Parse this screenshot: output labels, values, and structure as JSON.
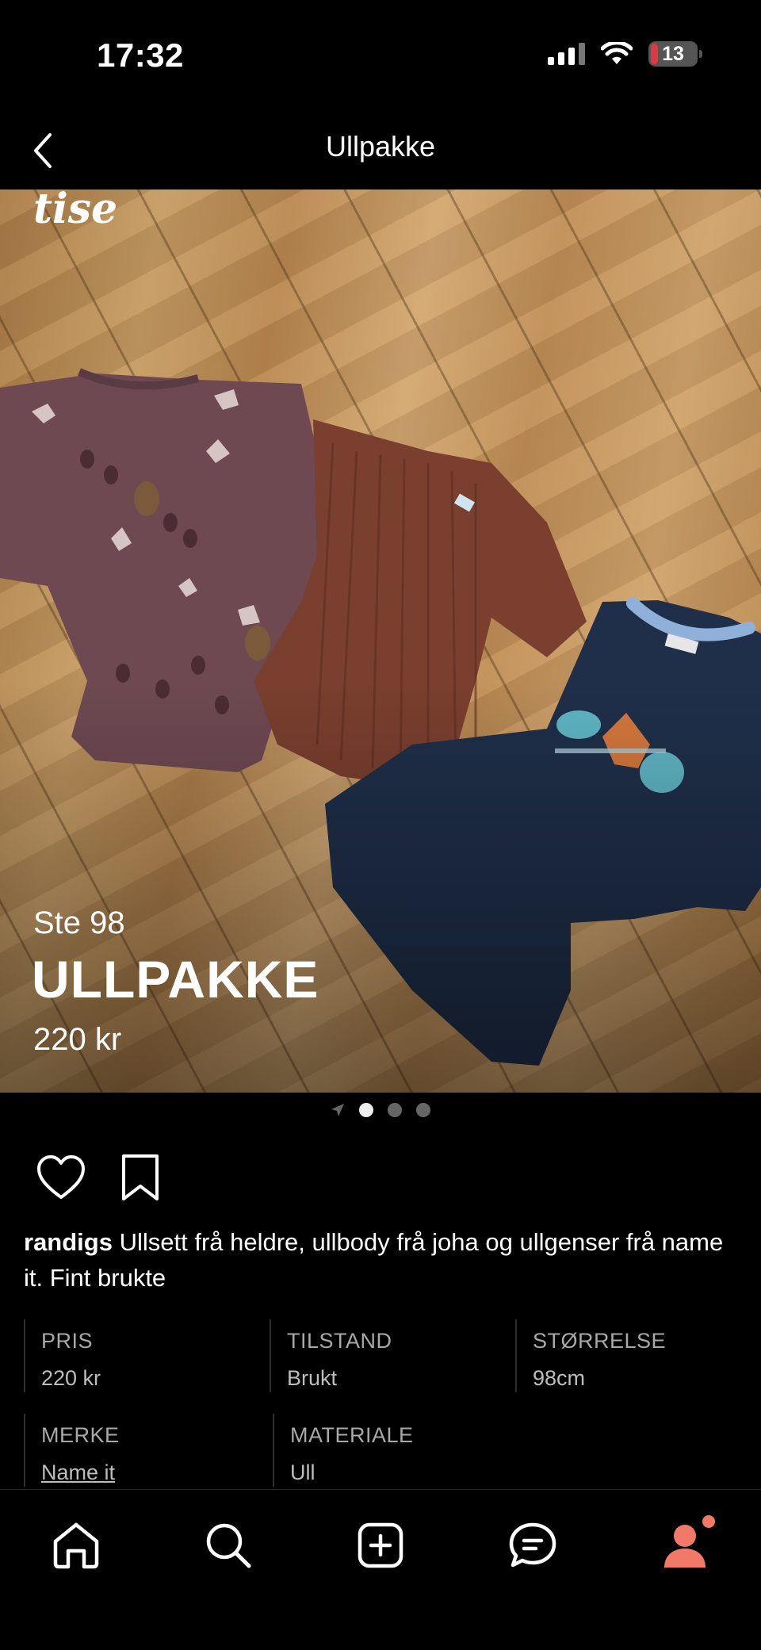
{
  "status_bar": {
    "time": "17:32",
    "battery": "13",
    "icons": [
      "signal-icon",
      "wifi-icon",
      "battery-icon"
    ]
  },
  "header": {
    "title": "Ullpakke",
    "back_icon": "chevron-left-icon"
  },
  "hero": {
    "watermark": "tise",
    "size": "Ste 98",
    "title": "ULLPAKKE",
    "price": "220 kr",
    "page_count": 3,
    "active_page": 1
  },
  "actions": {
    "icons": [
      "heart-icon",
      "bookmark-icon"
    ]
  },
  "description": {
    "username": "randigs",
    "text": "Ullsett frå heldre, ullbody frå joha og ullgenser frå name it. Fint brukte"
  },
  "details": [
    {
      "label": "PRIS",
      "value": "220 kr"
    },
    {
      "label": "TILSTAND",
      "value": "Brukt"
    },
    {
      "label": "STØRRELSE",
      "value": "98cm"
    },
    {
      "label": "MERKE",
      "value": "Name it"
    },
    {
      "label": "MATERIALE",
      "value": "Ull"
    }
  ],
  "tab_bar": {
    "tabs": [
      "home-icon",
      "search-icon",
      "add-icon",
      "chat-icon",
      "profile-icon"
    ],
    "accent_color": "#f07a67"
  }
}
